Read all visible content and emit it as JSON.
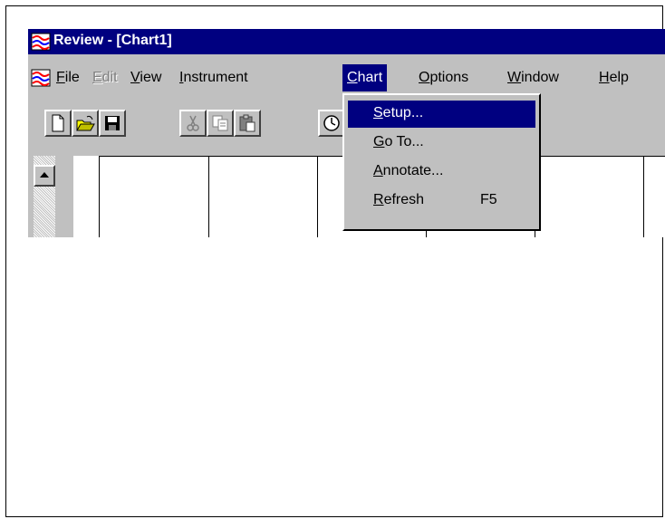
{
  "window": {
    "title": "Review - [Chart1]",
    "title_bar_color": "#000080"
  },
  "menu_bar": {
    "items": [
      {
        "label": "File",
        "mnemonic": "F",
        "rest": "ile",
        "state": "normal"
      },
      {
        "label": "Edit",
        "mnemonic": "E",
        "rest": "dit",
        "state": "disabled"
      },
      {
        "label": "View",
        "mnemonic": "V",
        "rest": "iew",
        "state": "normal"
      },
      {
        "label": "Instrument",
        "mnemonic": "I",
        "rest": "nstrument",
        "state": "normal"
      },
      {
        "label": "Chart",
        "mnemonic": "C",
        "rest": "hart",
        "state": "open"
      },
      {
        "label": "Options",
        "mnemonic": "O",
        "rest": "ptions",
        "state": "normal"
      },
      {
        "label": "Window",
        "mnemonic": "W",
        "rest": "indow",
        "state": "normal"
      },
      {
        "label": "Help",
        "mnemonic": "H",
        "rest": "elp",
        "state": "normal"
      }
    ]
  },
  "toolbar": {
    "buttons": [
      {
        "icon": "new-document-icon"
      },
      {
        "icon": "open-folder-icon"
      },
      {
        "icon": "save-disk-icon"
      },
      {
        "icon": "cut-scissors-icon",
        "state": "disabled"
      },
      {
        "icon": "copy-icon",
        "state": "disabled"
      },
      {
        "icon": "paste-icon",
        "state": "disabled"
      },
      {
        "icon": "clock-icon"
      }
    ]
  },
  "chart_menu": {
    "items": [
      {
        "label": "Setup...",
        "mnemonic": "S",
        "rest": "etup...",
        "selected": true
      },
      {
        "label": "Go To...",
        "mnemonic": "G",
        "rest": "o To...",
        "selected": false
      },
      {
        "label": "Annotate...",
        "mnemonic": "A",
        "rest": "nnotate...",
        "selected": false
      },
      {
        "label": "Refresh",
        "mnemonic": "R",
        "rest": "efresh",
        "shortcut": "F5",
        "selected": false
      }
    ]
  },
  "colors": {
    "face": "#c0c0c0",
    "highlight": "#000080",
    "disabled_text": "#808080"
  }
}
